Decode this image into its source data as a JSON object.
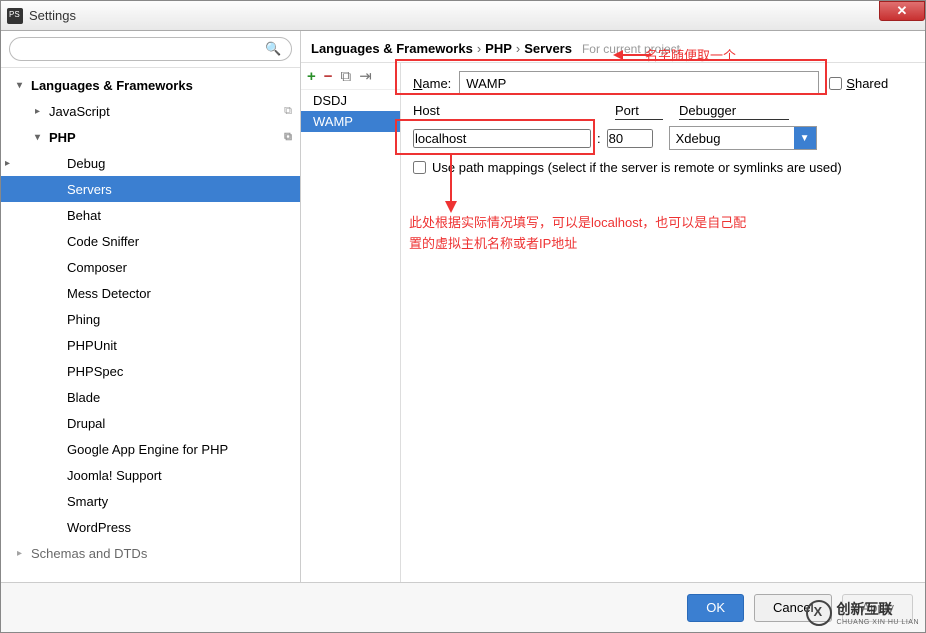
{
  "window": {
    "title": "Settings"
  },
  "search": {
    "placeholder": ""
  },
  "tree": {
    "root_label": "Languages & Frameworks",
    "items": [
      {
        "label": "JavaScript",
        "level": 2,
        "arrow": "▸",
        "copy": true
      },
      {
        "label": "PHP",
        "level": 2,
        "arrow": "▾",
        "bold": true,
        "copy": true
      },
      {
        "label": "Debug",
        "level": 3,
        "arrow": "▸"
      },
      {
        "label": "Servers",
        "level": 3,
        "selected": true
      },
      {
        "label": "Behat",
        "level": 3
      },
      {
        "label": "Code Sniffer",
        "level": 3
      },
      {
        "label": "Composer",
        "level": 3
      },
      {
        "label": "Mess Detector",
        "level": 3
      },
      {
        "label": "Phing",
        "level": 3
      },
      {
        "label": "PHPUnit",
        "level": 3
      },
      {
        "label": "PHPSpec",
        "level": 3
      },
      {
        "label": "Blade",
        "level": 3
      },
      {
        "label": "Drupal",
        "level": 3
      },
      {
        "label": "Google App Engine for PHP",
        "level": 3
      },
      {
        "label": "Joomla! Support",
        "level": 3
      },
      {
        "label": "Smarty",
        "level": 3
      },
      {
        "label": "WordPress",
        "level": 3
      }
    ],
    "footer_label": "Schemas and DTDs"
  },
  "breadcrumb": {
    "parts": [
      "Languages & Frameworks",
      "PHP",
      "Servers"
    ],
    "hint": "For current project"
  },
  "servers": {
    "toolbar": {
      "add": "+",
      "remove": "−",
      "copy": "⧉",
      "import": "⇥"
    },
    "list": [
      {
        "name": "DSDJ"
      },
      {
        "name": "WAMP",
        "selected": true
      }
    ]
  },
  "form": {
    "name_label": "Name:",
    "name_value": "WAMP",
    "shared_label": "Shared",
    "host_label": "Host",
    "port_label": "Port",
    "debugger_label": "Debugger",
    "host_value": "localhost",
    "port_value": "80",
    "debugger_value": "Xdebug",
    "mapping_label": "Use path mappings (select if the server is remote or symlinks are used)"
  },
  "annotations": {
    "top": "名字随便取一个",
    "body_line1": "此处根据实际情况填写，可以是localhost，也可以是自己配",
    "body_line2": "置的虚拟主机名称或者IP地址"
  },
  "footer": {
    "ok": "OK",
    "cancel": "Cancel",
    "apply": "Apply",
    "brand": "创新互联",
    "brand_sub": "CHUANG XIN HU LIAN"
  }
}
